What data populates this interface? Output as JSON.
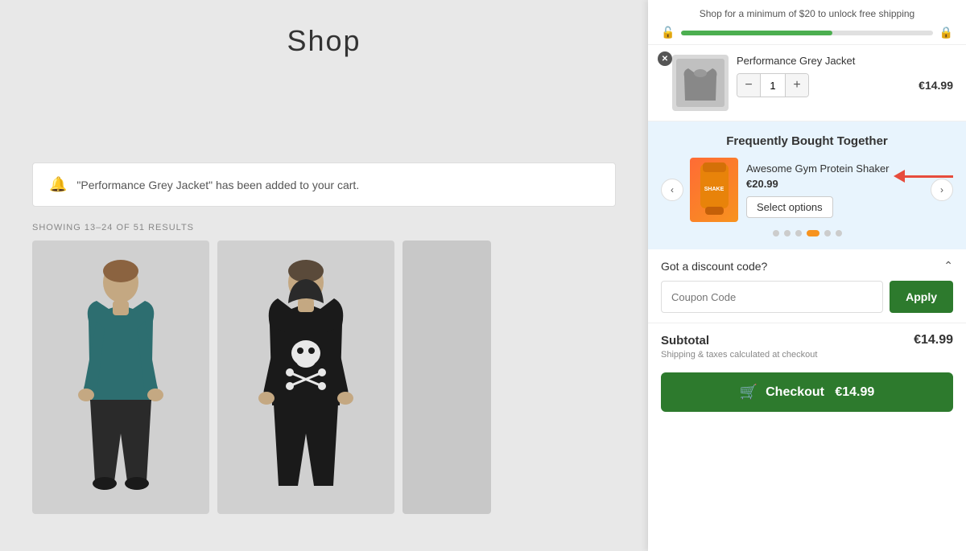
{
  "shop": {
    "title": "Shop",
    "results_label": "Showing 13–24 of 51 results",
    "notification": {
      "text": "\"Performance Grey Jacket\" has been added to your cart."
    }
  },
  "shipping_bar": {
    "message": "Shop for a minimum of $20 to unlock free shipping",
    "progress_percent": 60
  },
  "cart": {
    "item": {
      "name": "Performance Grey Jacket",
      "price": "€14.99",
      "quantity": 1
    },
    "fbt": {
      "title": "Frequently Bought Together",
      "product": {
        "name": "Awesome Gym Protein Shaker",
        "price": "€20.99",
        "select_btn_label": "Select options"
      },
      "dots": [
        false,
        false,
        false,
        true,
        false,
        false
      ]
    },
    "discount": {
      "header": "Got a discount code?",
      "placeholder": "Coupon Code",
      "apply_label": "Apply"
    },
    "subtotal": {
      "label": "Subtotal",
      "price": "€14.99",
      "note": "Shipping & taxes calculated at checkout"
    },
    "checkout": {
      "label": "Checkout",
      "price": "€14.99"
    }
  },
  "icons": {
    "bell": "🔔",
    "lock_open": "🔓",
    "lock_closed": "🔒",
    "chevron_up": "⌃",
    "minus": "−",
    "plus": "+",
    "left_arrow": "‹",
    "right_arrow": "›",
    "cart": "🛒",
    "close": "✕"
  }
}
